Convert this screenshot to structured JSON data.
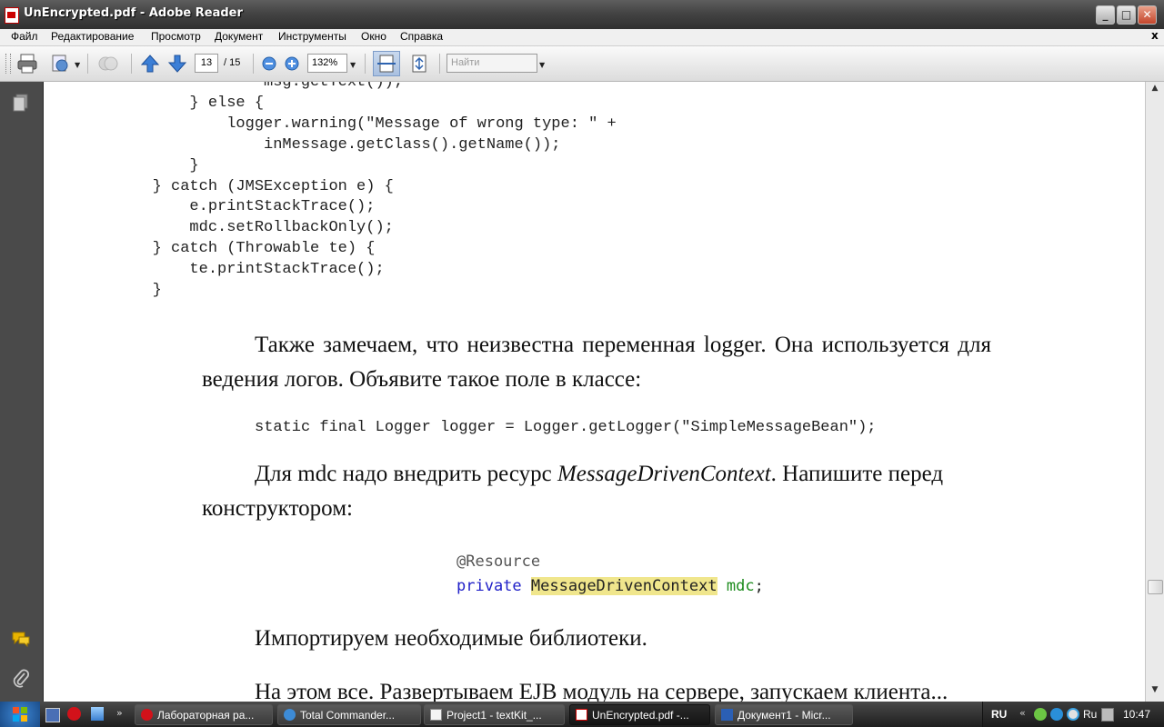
{
  "window": {
    "title": "UnEncrypted.pdf - Adobe Reader",
    "controls": {
      "minimize": "_",
      "maximize": "□",
      "close": "✕"
    }
  },
  "menu": {
    "items": [
      "Файл",
      "Редактирование",
      "Просмотр",
      "Документ",
      "Инструменты",
      "Окно",
      "Справка"
    ],
    "close_glyph": "x"
  },
  "toolbar": {
    "page_current": "13",
    "page_total": "/ 15",
    "zoom": "132%",
    "search_placeholder": "Найти",
    "icons": [
      "printer-icon",
      "share-icon",
      "collaborate-icon",
      "prev-page-icon",
      "next-page-icon",
      "zoom-out-icon",
      "zoom-in-icon",
      "fit-width-icon",
      "fit-page-icon"
    ]
  },
  "document": {
    "code_block_1": [
      "                    msg.getText());",
      "            } else {",
      "                logger.warning(\"Message of wrong type: \" +",
      "                    inMessage.getClass().getName());",
      "            }",
      "        } catch (JMSException e) {",
      "            e.printStackTrace();",
      "            mdc.setRollbackOnly();",
      "        } catch (Throwable te) {",
      "            te.printStackTrace();",
      "        }"
    ],
    "para1_line1": "Также замечаем, что неизвестна переменная logger. Она используется для",
    "para1_line2": "ведения логов. Объявите такое поле в классе:",
    "code_logger": "static final Logger logger = Logger.getLogger(\"SimpleMessageBean\");",
    "para2_line1_a": "Для mdc надо внедрить ресурс ",
    "para2_line1_em": "MessageDrivenContext",
    "para2_line1_b": ". Напишите перед",
    "para2_line2": "конструктором:",
    "ide_line1": "@Resource",
    "ide_line2_kw": "private",
    "ide_line2_type": "MessageDrivenContext",
    "ide_line2_var": "mdc",
    "ide_line2_end": ";",
    "para3": "Импортируем необходимые библиотеки.",
    "para4": "На этом все. Развертываем EJB модуль на сервере, запускаем клиента..."
  },
  "colors": {
    "ide_keyword": "#2020c8",
    "ide_variable": "#1e8c1e",
    "ide_highlight": "#f0e68c",
    "ide_annotation": "#555555"
  },
  "taskbar": {
    "tasks": [
      {
        "label": "Лабораторная ра...",
        "icon": "opera-icon"
      },
      {
        "label": "Total Commander...",
        "icon": "total-commander-icon"
      },
      {
        "label": "Project1 - textKit_...",
        "icon": "notepad-icon"
      },
      {
        "label": "UnEncrypted.pdf -...",
        "icon": "adobe-reader-icon"
      },
      {
        "label": "Документ1 - Micr...",
        "icon": "word-icon"
      }
    ],
    "lang": "RU",
    "lang_small": "Ru",
    "clock": "10:47"
  }
}
